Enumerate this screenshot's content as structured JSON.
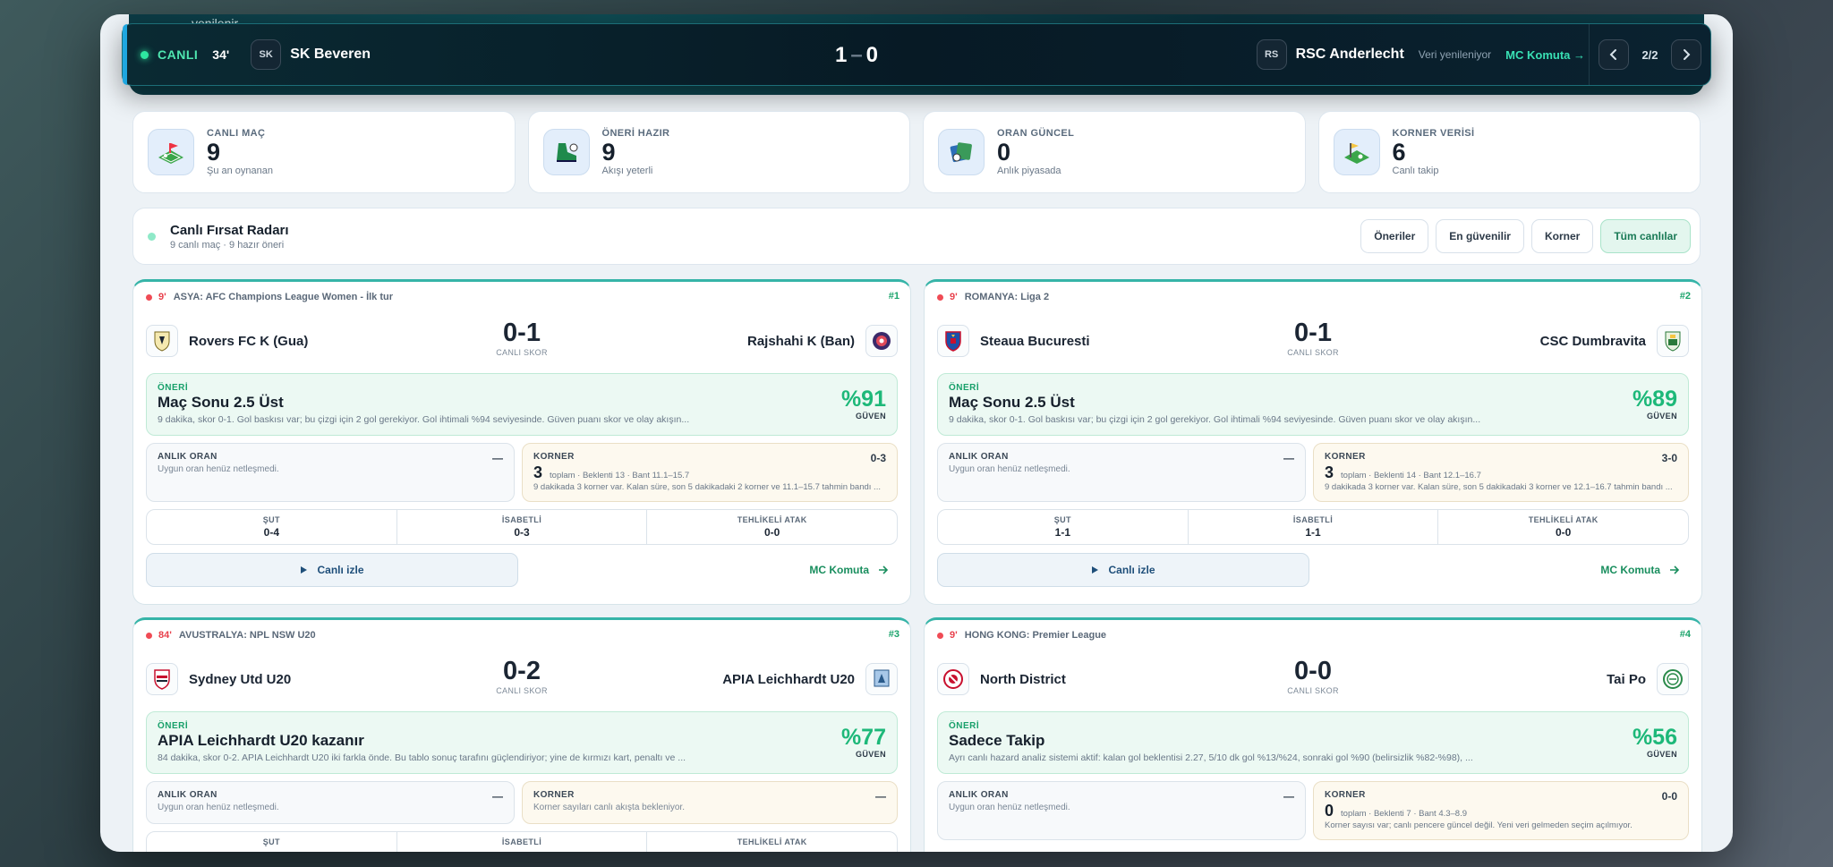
{
  "hero_cut_text": "yenilenir.",
  "live_bar": {
    "status": "CANLI",
    "minute": "34'",
    "home_abbr": "SK",
    "home_name": "SK Beveren",
    "home_score": "1",
    "away_score": "0",
    "away_abbr": "RS",
    "away_name": "RSC Anderlecht",
    "refresh_text": "Veri yenileniyor",
    "mc_link": "MC Komuta →",
    "pager_text": "2/2",
    "prev_icon": "chevron-left-icon",
    "next_icon": "chevron-right-icon"
  },
  "stats": [
    {
      "label": "CANLI MAÇ",
      "value": "9",
      "sub": "Şu an oynanan",
      "icon": "pitch-live-icon"
    },
    {
      "label": "ÖNERİ HAZIR",
      "value": "9",
      "sub": "Akışı yeterli",
      "icon": "boot-icon"
    },
    {
      "label": "ORAN GÜNCEL",
      "value": "0",
      "sub": "Anlık piyasada",
      "icon": "odds-icon"
    },
    {
      "label": "KORNER VERİSİ",
      "value": "6",
      "sub": "Canlı takip",
      "icon": "corner-flag-icon"
    }
  ],
  "radar": {
    "title": "Canlı Fırsat Radarı",
    "sub": "9 canlı maç · 9 hazır öneri",
    "filters": [
      "Öneriler",
      "En güvenilir",
      "Korner",
      "Tüm canlılar"
    ],
    "active_filter": "Tüm canlılar"
  },
  "colors": {
    "accent": "#1db879",
    "live": "#e8414c",
    "bar_bg": "#071a25"
  },
  "matches": [
    {
      "minute": "9'",
      "league": "ASYA: AFC Champions League Women - İlk tur",
      "rank": "#1",
      "home": "Rovers FC K (Gua)",
      "away": "Rajshahi K (Ban)",
      "score": "0-1",
      "score_label": "CANLI SKOR",
      "reco_label": "ÖNERİ",
      "reco_title": "Maç Sonu 2.5 Üst",
      "reco_desc": "9 dakika, skor 0-1. Gol baskısı var; bu çizgi için 2 gol gerekiyor. Gol ihtimali %94 seviyesinde. Güven puanı skor ve olay akışın...",
      "pct": "%91",
      "pct_label": "GÜVEN",
      "odds_label": "ANLIK ORAN",
      "odds_sub": "Uygun oran henüz netleşmedi.",
      "odds_value": "—",
      "corner_label": "KORNER",
      "corner_score": "0-3",
      "corner_total": "3",
      "corner_meta": "toplam · Beklenti 13 · Bant 11.1–15.7",
      "corner_desc": "9 dakikada 3 korner var. Kalan süre, son 5 dakikadaki 2 korner ve 11.1–15.7 tahmin bandı ...",
      "shot_label": "ŞUT",
      "shot": "0-4",
      "on_target_label": "İSABETLİ",
      "on_target": "0-3",
      "danger_label": "TEHLİKELİ ATAK",
      "danger": "0-0",
      "watch_label": "Canlı izle",
      "mc_label": "MC Komuta"
    },
    {
      "minute": "9'",
      "league": "ROMANYA: Liga 2",
      "rank": "#2",
      "home": "Steaua Bucuresti",
      "away": "CSC Dumbravita",
      "score": "0-1",
      "score_label": "CANLI SKOR",
      "reco_label": "ÖNERİ",
      "reco_title": "Maç Sonu 2.5 Üst",
      "reco_desc": "9 dakika, skor 0-1. Gol baskısı var; bu çizgi için 2 gol gerekiyor. Gol ihtimali %94 seviyesinde. Güven puanı skor ve olay akışın...",
      "pct": "%89",
      "pct_label": "GÜVEN",
      "odds_label": "ANLIK ORAN",
      "odds_sub": "Uygun oran henüz netleşmedi.",
      "odds_value": "—",
      "corner_label": "KORNER",
      "corner_score": "3-0",
      "corner_total": "3",
      "corner_meta": "toplam · Beklenti 14 · Bant 12.1–16.7",
      "corner_desc": "9 dakikada 3 korner var. Kalan süre, son 5 dakikadaki 3 korner ve 12.1–16.7 tahmin bandı ...",
      "shot_label": "ŞUT",
      "shot": "1-1",
      "on_target_label": "İSABETLİ",
      "on_target": "1-1",
      "danger_label": "TEHLİKELİ ATAK",
      "danger": "0-0",
      "watch_label": "Canlı izle",
      "mc_label": "MC Komuta"
    },
    {
      "minute": "84'",
      "league": "AVUSTRALYA: NPL NSW U20",
      "rank": "#3",
      "home": "Sydney Utd U20",
      "away": "APIA Leichhardt U20",
      "score": "0-2",
      "score_label": "CANLI SKOR",
      "reco_label": "ÖNERİ",
      "reco_title": "APIA Leichhardt U20 kazanır",
      "reco_desc": "84 dakika, skor 0-2. APIA Leichhardt U20 iki farkla önde. Bu tablo sonuç tarafını güçlendiriyor; yine de kırmızı kart, penaltı ve ...",
      "pct": "%77",
      "pct_label": "GÜVEN",
      "odds_label": "ANLIK ORAN",
      "odds_sub": "Uygun oran henüz netleşmedi.",
      "odds_value": "—",
      "corner_label": "KORNER",
      "corner_score": "—",
      "corner_total": "",
      "corner_meta": "",
      "corner_desc": "Korner sayıları canlı akışta bekleniyor.",
      "shot_label": "ŞUT",
      "shot": "",
      "on_target_label": "İSABETLİ",
      "on_target": "",
      "danger_label": "TEHLİKELİ ATAK",
      "danger": "",
      "watch_label": "",
      "mc_label": ""
    },
    {
      "minute": "9'",
      "league": "HONG KONG: Premier League",
      "rank": "#4",
      "home": "North District",
      "away": "Tai Po",
      "score": "0-0",
      "score_label": "CANLI SKOR",
      "reco_label": "ÖNERİ",
      "reco_title": "Sadece Takip",
      "reco_desc": "Ayrı canlı hazard analiz sistemi aktif: kalan gol beklentisi 2.27, 5/10 dk gol %13/%24, sonraki gol %90 (belirsizlik %82-%98), ...",
      "pct": "%56",
      "pct_label": "GÜVEN",
      "odds_label": "ANLIK ORAN",
      "odds_sub": "Uygun oran henüz netleşmedi.",
      "odds_value": "—",
      "corner_label": "KORNER",
      "corner_score": "0-0",
      "corner_total": "0",
      "corner_meta": "toplam · Beklenti 7 · Bant 4.3–8.9",
      "corner_desc": "Korner sayısı var; canlı pencere güncel değil. Yeni veri gelmeden seçim açılmıyor.",
      "shot_label": "",
      "shot": "",
      "on_target_label": "",
      "on_target": "",
      "danger_label": "",
      "danger": "",
      "watch_label": "",
      "mc_label": ""
    }
  ]
}
